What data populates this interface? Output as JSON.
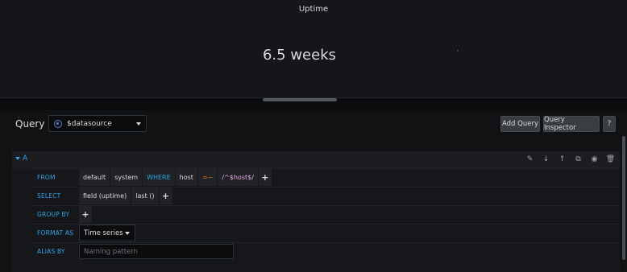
{
  "panel": {
    "title": "Uptime",
    "value": "6.5 weeks"
  },
  "query": {
    "label": "Query",
    "datasource": "$datasource",
    "add_query": "Add Query",
    "query_inspector": "Query Inspector",
    "help": "?"
  },
  "query_row": {
    "letter": "A",
    "from": {
      "label": "FROM",
      "policy": "default",
      "measurement": "system",
      "where_kw": "WHERE",
      "tag": "host",
      "operator": "=~",
      "value": "/^$host$/",
      "add": "+"
    },
    "select": {
      "label": "SELECT",
      "field": "field (uptime)",
      "fn": "last ()",
      "add": "+"
    },
    "group_by": {
      "label": "GROUP BY",
      "add": "+"
    },
    "format_as": {
      "label": "FORMAT AS",
      "value": "Time series"
    },
    "alias_by": {
      "label": "ALIAS BY",
      "placeholder": "Naming pattern"
    }
  }
}
